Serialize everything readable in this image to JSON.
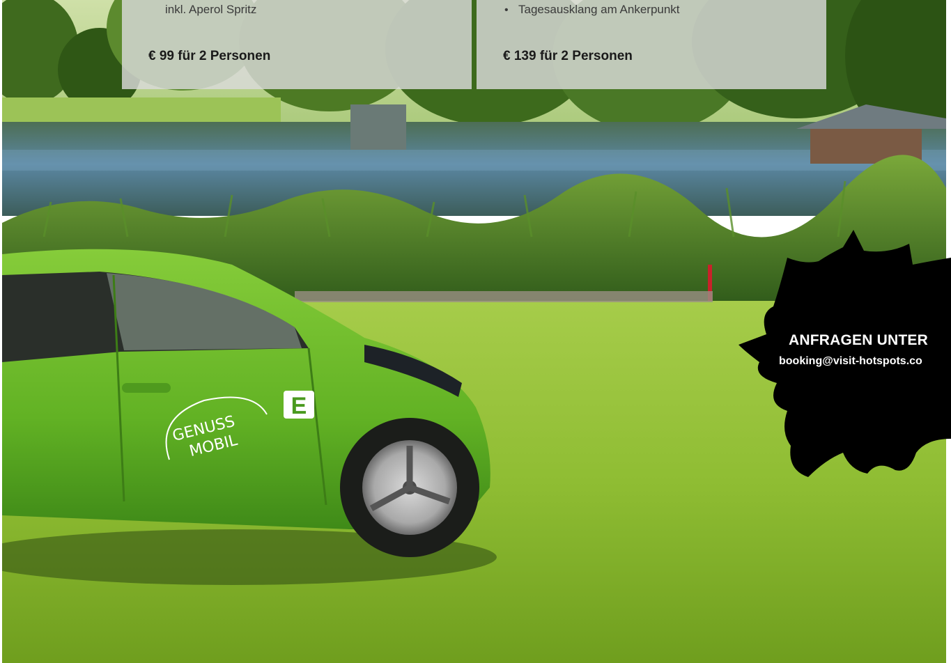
{
  "offer_left": {
    "line": "inkl. Aperol Spritz",
    "price": "€ 99 für 2 Personen"
  },
  "offer_right": {
    "line": "Tagesausklang am Ankerpunkt",
    "price": "€ 139 für 2 Personen"
  },
  "contact": {
    "title": "ANFRAGEN UNTER",
    "email": "booking@visit-hotspots.co"
  },
  "car_decal": {
    "line1": "GENUSS",
    "line2": "MOBIL",
    "logo_letter": "E"
  },
  "colors": {
    "card_bg": "#dadada",
    "splat": "#000000",
    "car_green": "#6fbf2c",
    "grass": "#8dbb33",
    "water": "#3f6d86"
  }
}
